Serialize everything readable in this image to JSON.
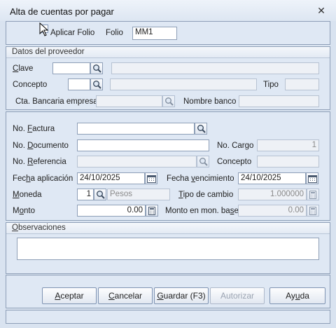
{
  "window": {
    "title": "Alta de cuentas por pagar"
  },
  "header": {
    "aplicar_folio_label": "Aplicar Folio",
    "folio_label": "Folio",
    "folio_value": "MM1",
    "aplicar_folio_checked": false
  },
  "proveedor": {
    "group_title": "Datos del proveedor",
    "clave_label": "Clave",
    "clave_value": "",
    "clave_name_value": "",
    "concepto_label": "Concepto",
    "concepto_value": "",
    "concepto_desc_value": "",
    "tipo_label": "Tipo",
    "tipo_value": "",
    "cta_bancaria_label": "Cta. Bancaria empresa",
    "cta_bancaria_value": "",
    "nombre_banco_label": "Nombre banco",
    "nombre_banco_value": ""
  },
  "documento": {
    "no_factura_label": "No. Factura",
    "no_factura_value": "",
    "no_documento_label": "No. Documento",
    "no_documento_value": "",
    "no_cargo_label": "No. Cargo",
    "no_cargo_value": "1",
    "no_referencia_label": "No. Referencia",
    "no_referencia_value": "",
    "concepto_label": "Concepto",
    "concepto_value": "",
    "fecha_aplicacion_label": "Fecha aplicación",
    "fecha_aplicacion_value": "24/10/2025",
    "fecha_vencimiento_label": "Fecha vencimiento",
    "fecha_vencimiento_value": "24/10/2025",
    "moneda_label": "Moneda",
    "moneda_value": "1",
    "moneda_name": "Pesos",
    "tipo_cambio_label": "Tipo de cambio",
    "tipo_cambio_value": "1.000000",
    "monto_label": "Monto",
    "monto_value": "0.00",
    "monto_base_label": "Monto en mon. base",
    "monto_base_value": "0.00"
  },
  "observaciones": {
    "group_title": "Observaciones",
    "value": ""
  },
  "buttons": {
    "aceptar": "Aceptar",
    "cancelar": "Cancelar",
    "guardar": "Guardar (F3)",
    "autorizar": "Autorizar",
    "ayuda": "Ayuda"
  },
  "icons": {
    "search": "magnifier-icon",
    "calendar": "calendar-icon",
    "calculator": "calculator-icon",
    "close": "close-icon"
  }
}
